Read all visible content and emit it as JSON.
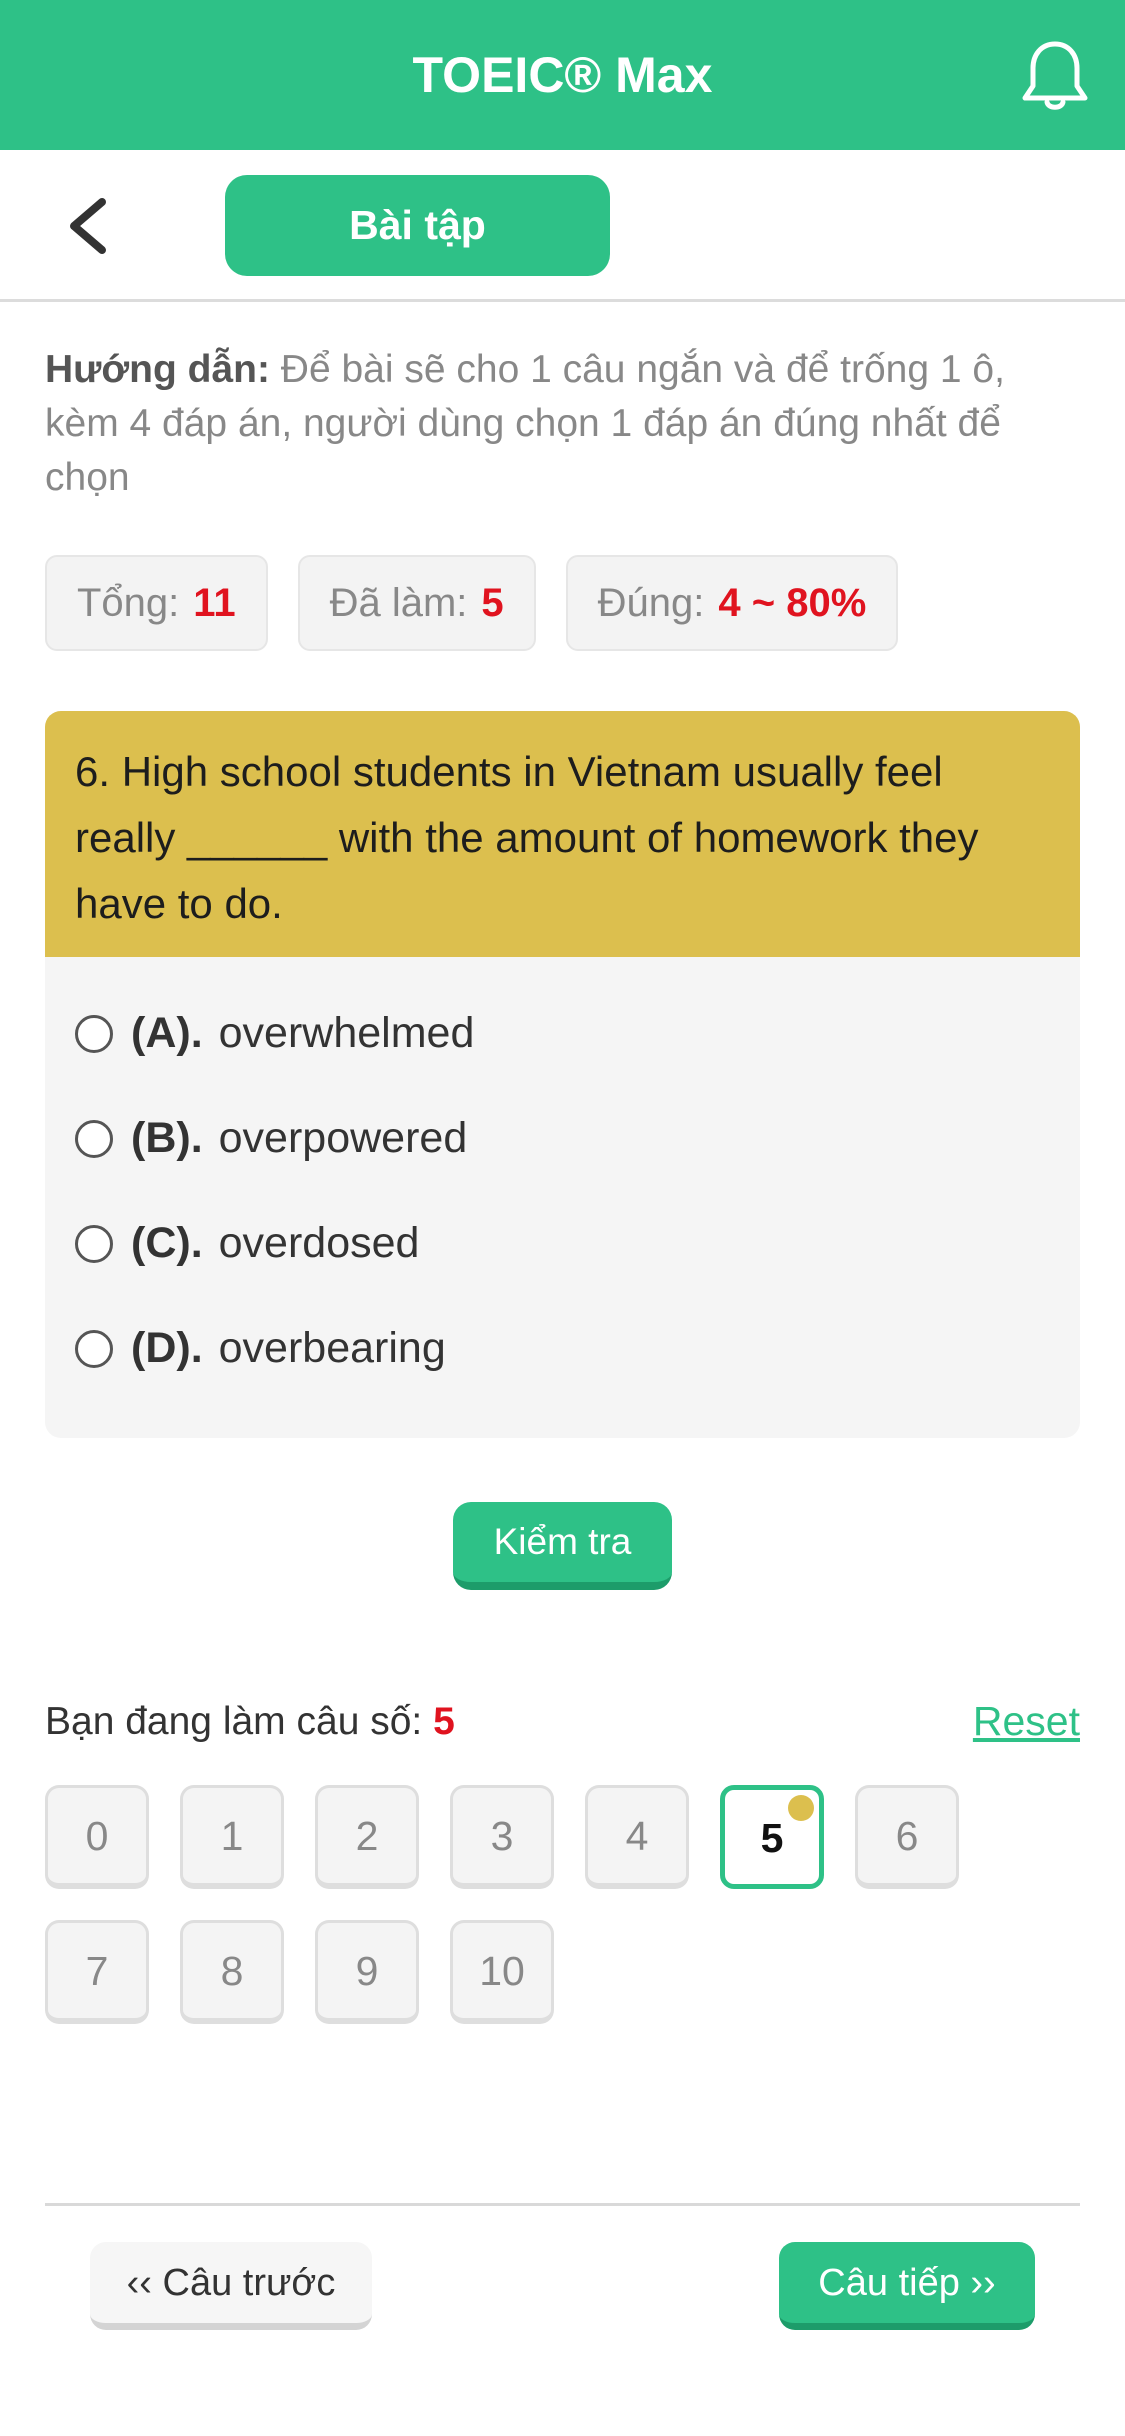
{
  "header": {
    "title": "TOEIC® Max",
    "bell_icon": "bell-icon"
  },
  "subbar": {
    "tab_label": "Bài tập",
    "back_icon": "chevron-left-icon"
  },
  "instructions": {
    "label": "Hướng dẫn:",
    "text": "Để bài sẽ cho 1 câu ngắn và để trống 1 ô, kèm 4 đáp án, người dùng chọn 1 đáp án đúng nhất để chọn"
  },
  "stats": [
    {
      "label": "Tổng:",
      "value": "11"
    },
    {
      "label": "Đã làm:",
      "value": "5"
    },
    {
      "label": "Đúng:",
      "value": "4 ~ 80%"
    }
  ],
  "question": {
    "text": "6. High school students in Vietnam usually feel really ______ with the amount of homework they have to do.",
    "options": [
      {
        "letter": "(A).",
        "text": "overwhelmed"
      },
      {
        "letter": "(B).",
        "text": "overpowered"
      },
      {
        "letter": "(C).",
        "text": "overdosed"
      },
      {
        "letter": "(D).",
        "text": "overbearing"
      }
    ]
  },
  "check_button": "Kiểm tra",
  "progress": {
    "label": "Bạn đang làm câu số:",
    "current": "5",
    "reset": "Reset"
  },
  "question_numbers": [
    "0",
    "1",
    "2",
    "3",
    "4",
    "5",
    "6",
    "7",
    "8",
    "9",
    "10"
  ],
  "current_index": 5,
  "nav": {
    "prev": "‹‹ Câu trước",
    "next": "Câu tiếp ››"
  },
  "colors": {
    "primary": "#2ec187",
    "question_bg": "#dcbf4e",
    "highlight": "#e0131f"
  }
}
